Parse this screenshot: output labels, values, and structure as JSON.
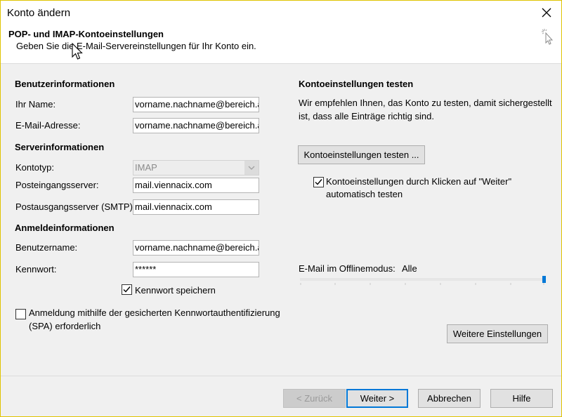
{
  "window": {
    "title": "Konto ändern"
  },
  "header": {
    "title": "POP- und IMAP-Kontoeinstellungen",
    "subtitle": "Geben Sie die E-Mail-Servereinstellungen für Ihr Konto ein."
  },
  "user_info": {
    "heading": "Benutzerinformationen",
    "name_label": "Ihr Name:",
    "name_value": "vorname.nachname@bereich.at",
    "email_label": "E-Mail-Adresse:",
    "email_value": "vorname.nachname@bereich.at"
  },
  "server_info": {
    "heading": "Serverinformationen",
    "account_type_label": "Kontotyp:",
    "account_type_value": "IMAP",
    "incoming_label": "Posteingangsserver:",
    "incoming_value": "mail.viennacix.com",
    "outgoing_label": "Postausgangsserver (SMTP):",
    "outgoing_value": "mail.viennacix.com"
  },
  "login_info": {
    "heading": "Anmeldeinformationen",
    "username_label": "Benutzername:",
    "username_value": "vorname.nachname@bereich.at",
    "password_label": "Kennwort:",
    "password_value": "******",
    "remember_password_label": "Kennwort speichern",
    "remember_password_checked": true,
    "spa_label_line1": "Anmeldung mithilfe der gesicherten Kennwortauthentifizierung",
    "spa_label_line2": "(SPA) erforderlich",
    "spa_checked": false
  },
  "test_settings": {
    "heading": "Kontoeinstellungen testen",
    "description_line1": "Wir empfehlen Ihnen, das Konto zu testen, damit sichergestellt",
    "description_line2": "ist, dass alle Einträge richtig sind.",
    "test_button_label": "Kontoeinstellungen testen ...",
    "auto_test_label_line1": "Kontoeinstellungen durch Klicken auf \"Weiter\"",
    "auto_test_label_line2": "automatisch testen",
    "auto_test_checked": true
  },
  "offline": {
    "label": "E-Mail im Offlinemodus:",
    "value": "Alle",
    "slider_level": 1.0
  },
  "more_settings_label": "Weitere Einstellungen",
  "footer": {
    "back_label": "< Zurück",
    "next_label": "Weiter >",
    "cancel_label": "Abbrechen",
    "help_label": "Hilfe"
  },
  "colors": {
    "accent": "#0078d7",
    "window_border": "#e0c400"
  }
}
